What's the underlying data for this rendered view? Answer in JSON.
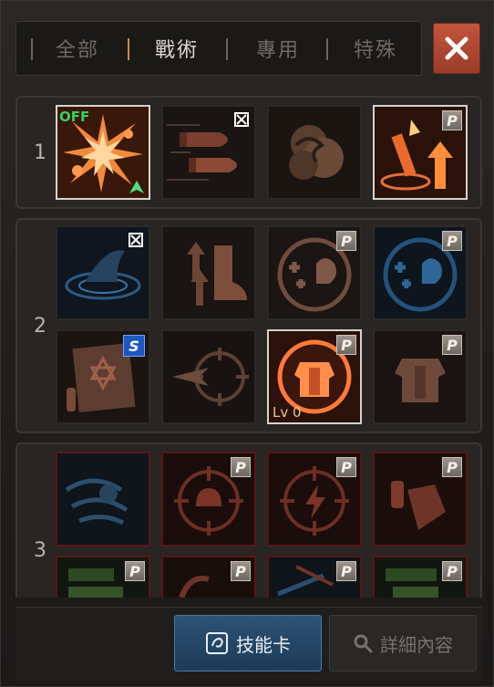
{
  "tabs": [
    {
      "label": "全部",
      "active": false
    },
    {
      "label": "戰術",
      "active": true
    },
    {
      "label": "專用",
      "active": false
    },
    {
      "label": "特殊",
      "active": false
    }
  ],
  "close_icon": "close-x-icon",
  "groups": [
    {
      "number": "1"
    },
    {
      "number": "2"
    },
    {
      "number": "3"
    }
  ],
  "slot_text": {
    "off": "OFF",
    "level": "Lv 0",
    "passive_badge": "P",
    "special_badge": "S"
  },
  "bottom": {
    "skill_card_label": "技能卡",
    "detail_label": "詳細內容"
  },
  "colors": {
    "accent_orange": "#f08a3c",
    "active_tab_marker": "#d08a40",
    "off_green": "#37d25a",
    "skill_card_blue": "#2d5275",
    "special_blue": "#1d58c2",
    "locked_red": "#5a1614"
  }
}
